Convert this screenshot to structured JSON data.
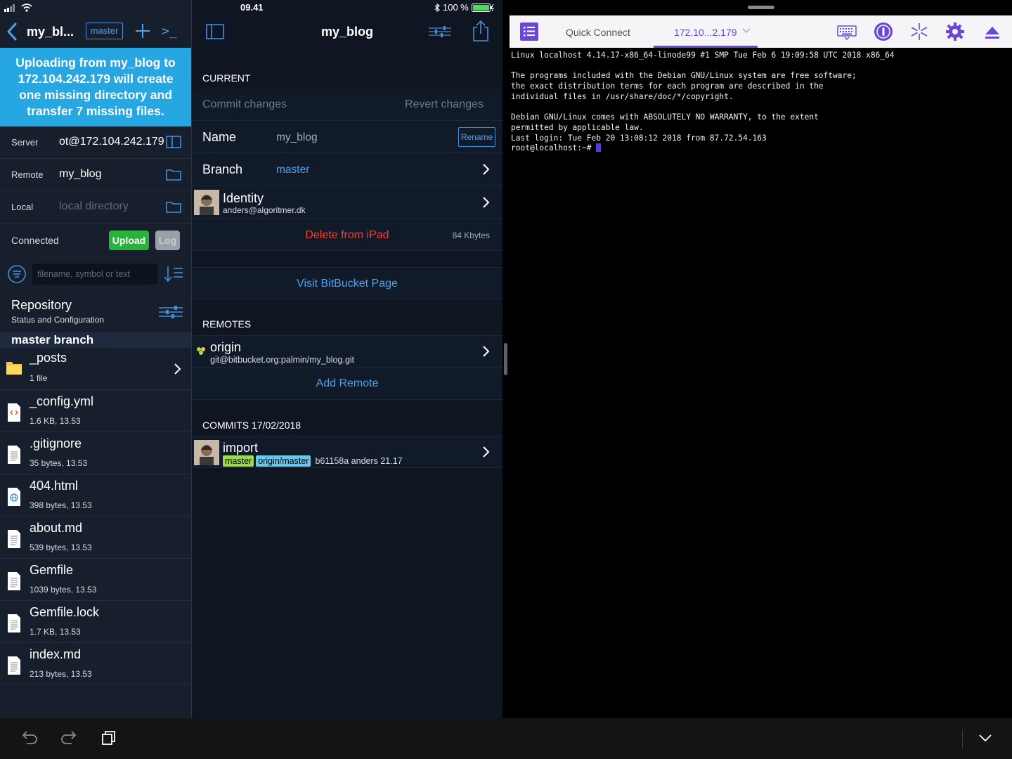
{
  "status": {
    "time": "09.41",
    "battery": "100 %"
  },
  "left": {
    "title": "my_bl...",
    "branch_badge": "master",
    "term_label": ">_",
    "banner": "Uploading from my_blog to 172.104.242.179 will create one missing directory and transfer 7 missing files.",
    "server_label": "Server",
    "server_value": "ot@172.104.242.179",
    "remote_label": "Remote",
    "remote_value": "my_blog",
    "local_label": "Local",
    "local_placeholder": "local directory",
    "connected_label": "Connected",
    "upload_label": "Upload",
    "log_label": "Log",
    "filter_placeholder": "filename, symbol or text",
    "repo_title": "Repository",
    "repo_sub": "Status and Configuration",
    "section": "master branch",
    "files": [
      {
        "name": "_posts",
        "meta": "1 file",
        "kind": "folder"
      },
      {
        "name": "_config.yml",
        "meta": "1.6 KB, 13.53",
        "kind": "code"
      },
      {
        "name": ".gitignore",
        "meta": "35 bytes, 13.53",
        "kind": "text"
      },
      {
        "name": "404.html",
        "meta": "398 bytes, 13.53",
        "kind": "web"
      },
      {
        "name": "about.md",
        "meta": "539 bytes, 13.53",
        "kind": "text"
      },
      {
        "name": "Gemfile",
        "meta": "1039 bytes, 13.53",
        "kind": "text"
      },
      {
        "name": "Gemfile.lock",
        "meta": "1.7 KB, 13.53",
        "kind": "text"
      },
      {
        "name": "index.md",
        "meta": "213 bytes, 13.53",
        "kind": "text"
      }
    ]
  },
  "mid": {
    "title": "my_blog",
    "current_label": "CURRENT",
    "commit_changes": "Commit changes",
    "revert_changes": "Revert changes",
    "name_label": "Name",
    "name_value": "my_blog",
    "rename_label": "Rename",
    "branch_label": "Branch",
    "branch_value": "master",
    "identity_label": "Identity",
    "identity_email": "anders@algoritmer.dk",
    "delete_label": "Delete from iPad",
    "size_label": "84 Kbytes",
    "visit_label": "Visit BitBucket Page",
    "remotes_label": "REMOTES",
    "remote_name": "origin",
    "remote_url": "git@bitbucket.org:palmin/my_blog.git",
    "add_remote": "Add Remote",
    "commits_label": "COMMITS 17/02/2018",
    "commit_title": "import",
    "commit_tag1": "master",
    "commit_tag2": "origin/master",
    "commit_meta": "b61158a anders 21.17"
  },
  "right": {
    "tab_quick": "Quick Connect",
    "tab_host": "172.10...2.179",
    "terminal_lines": [
      "Linux localhost 4.14.17-x86_64-linode99 #1 SMP Tue Feb 6 19:09:58 UTC 2018 x86_64",
      "",
      "The programs included with the Debian GNU/Linux system are free software;",
      "the exact distribution terms for each program are described in the",
      "individual files in /usr/share/doc/*/copyright.",
      "",
      "Debian GNU/Linux comes with ABSOLUTELY NO WARRANTY, to the extent",
      "permitted by applicable law.",
      "Last login: Tue Feb 20 13:08:12 2018 from 87.72.54.163"
    ],
    "prompt": "root@localhost:~# "
  },
  "colors": {
    "accent": "#4aa2f0",
    "banner": "#27a7e2",
    "upload": "#29b33c",
    "danger": "#ff3b30",
    "terminal_accent": "#6a48d7"
  },
  "icons": [
    "back-chevron-icon",
    "plus-icon",
    "terminal-icon",
    "split-view-icon",
    "folder-icon",
    "filter-icon",
    "sort-icon",
    "sliders-icon",
    "share-icon",
    "chevron-right-icon",
    "list-menu-icon",
    "keyboard-icon",
    "info-icon",
    "sparkle-icon",
    "gear-icon",
    "eject-icon",
    "undo-icon",
    "redo-icon",
    "copy-icon",
    "chevron-down-icon"
  ]
}
